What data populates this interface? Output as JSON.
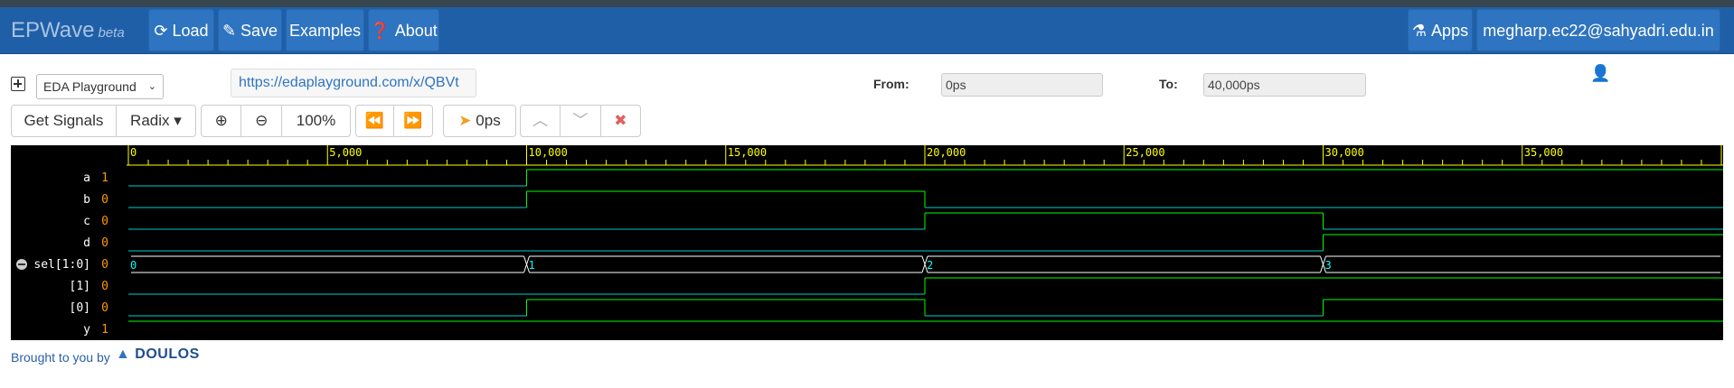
{
  "navbar": {
    "brand": "EPWave",
    "brand_suffix": "beta",
    "load_label": "Load",
    "save_label": "Save",
    "examples_label": "Examples",
    "about_label": "About",
    "apps_label": "Apps",
    "user_label": "megharp.ec22@sahyadri.edu.in",
    "bg_color": "#1f5fa7"
  },
  "toolbar": {
    "playground_select": "EDA Playground",
    "url": "https://edaplayground.com/x/QBVt",
    "from_label": "From:",
    "from_value": "0ps",
    "to_label": "To:",
    "to_value": "40,000ps",
    "get_signals_label": "Get Signals",
    "radix_label": "Radix",
    "zoom_level": "100%",
    "cursor_time": "0ps"
  },
  "footer": {
    "brought_by": "Brought to you by",
    "brand": "DOULOS"
  },
  "waveform": {
    "time_end_ps": 40000,
    "tick_labels": [
      "0",
      "5,000",
      "10,000",
      "15,000",
      "20,000",
      "25,000",
      "30,000",
      "35,000"
    ],
    "ruler_color": "#ffff00",
    "signals": [
      {
        "name": "a",
        "value": "1",
        "transitions": [
          [
            0,
            0
          ],
          [
            10000,
            1
          ]
        ]
      },
      {
        "name": "b",
        "value": "0",
        "transitions": [
          [
            0,
            0
          ],
          [
            10000,
            1
          ],
          [
            20000,
            0
          ]
        ]
      },
      {
        "name": "c",
        "value": "0",
        "transitions": [
          [
            0,
            0
          ],
          [
            20000,
            1
          ],
          [
            30000,
            0
          ]
        ]
      },
      {
        "name": "d",
        "value": "0",
        "transitions": [
          [
            0,
            0
          ],
          [
            30000,
            1
          ]
        ]
      },
      {
        "name": "sel[1:0]",
        "value": "0",
        "bus": true,
        "values": [
          [
            0,
            "0"
          ],
          [
            10000,
            "1"
          ],
          [
            20000,
            "2"
          ],
          [
            30000,
            "3"
          ]
        ]
      },
      {
        "name": "[1]",
        "value": "0",
        "transitions": [
          [
            0,
            0
          ],
          [
            20000,
            1
          ]
        ]
      },
      {
        "name": "[0]",
        "value": "0",
        "transitions": [
          [
            0,
            0
          ],
          [
            10000,
            1
          ],
          [
            20000,
            0
          ],
          [
            30000,
            1
          ]
        ]
      },
      {
        "name": "y",
        "value": "1",
        "transitions": [
          [
            0,
            1
          ]
        ]
      }
    ]
  }
}
